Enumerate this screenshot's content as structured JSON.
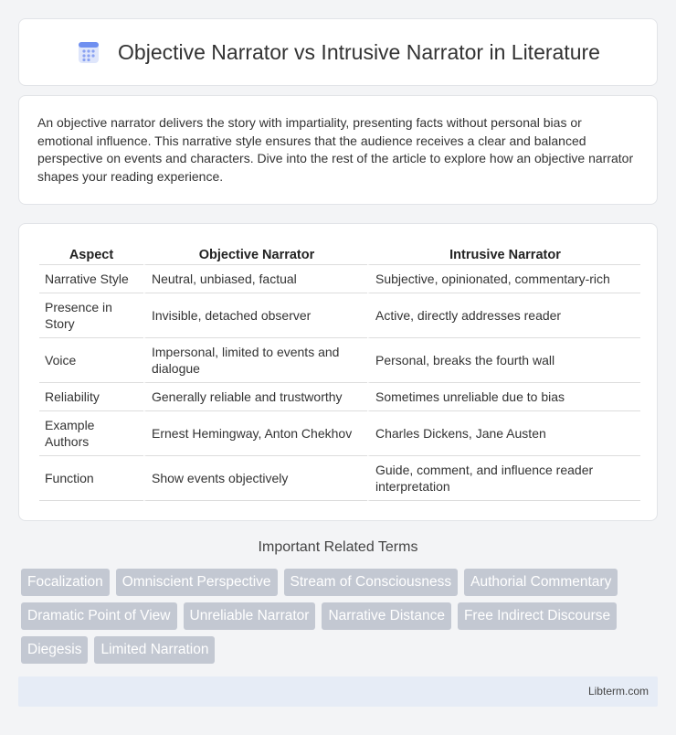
{
  "header": {
    "title": "Objective Narrator vs Intrusive Narrator in Literature",
    "icon": "document-list-icon"
  },
  "intro": {
    "text": "An objective narrator delivers the story with impartiality, presenting facts without personal bias or emotional influence. This narrative style ensures that the audience receives a clear and balanced perspective on events and characters. Dive into the rest of the article to explore how an objective narrator shapes your reading experience."
  },
  "table": {
    "headers": [
      "Aspect",
      "Objective Narrator",
      "Intrusive Narrator"
    ],
    "rows": [
      [
        "Narrative Style",
        "Neutral, unbiased, factual",
        "Subjective, opinionated, commentary-rich"
      ],
      [
        "Presence in Story",
        "Invisible, detached observer",
        "Active, directly addresses reader"
      ],
      [
        "Voice",
        "Impersonal, limited to events and dialogue",
        "Personal, breaks the fourth wall"
      ],
      [
        "Reliability",
        "Generally reliable and trustworthy",
        "Sometimes unreliable due to bias"
      ],
      [
        "Example Authors",
        "Ernest Hemingway, Anton Chekhov",
        "Charles Dickens, Jane Austen"
      ],
      [
        "Function",
        "Show events objectively",
        "Guide, comment, and influence reader interpretation"
      ]
    ]
  },
  "related": {
    "heading": "Important Related Terms",
    "tags": [
      "Focalization",
      "Omniscient Perspective",
      "Stream of Consciousness",
      "Authorial Commentary",
      "Dramatic Point of View",
      "Unreliable Narrator",
      "Narrative Distance",
      "Free Indirect Discourse",
      "Diegesis",
      "Limited Narration"
    ]
  },
  "footer": {
    "text": "Libterm.com"
  },
  "colors": {
    "tag_bg": "#c3c8d2",
    "footer_bg": "#e6ecf6",
    "page_bg": "#f3f4f6"
  }
}
